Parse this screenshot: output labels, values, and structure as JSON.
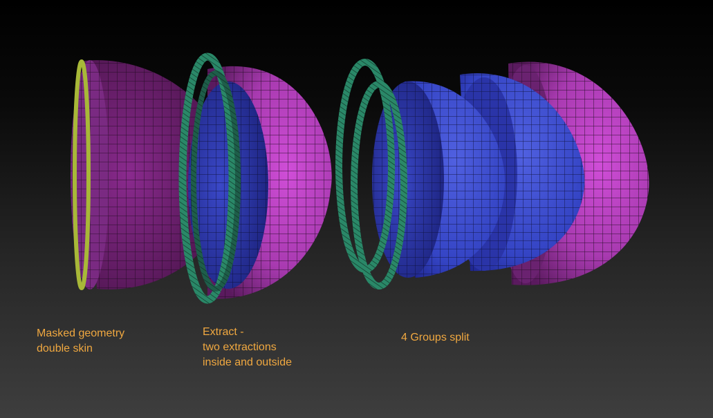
{
  "captions": {
    "masked": {
      "line1": "Masked geometry",
      "line2": "double skin"
    },
    "extract": {
      "line1": "Extract -",
      "line2": "two extractions",
      "line3": "inside and outside"
    },
    "groups": {
      "line1": "4 Groups split"
    }
  },
  "colors": {
    "magenta": "#b43cbc",
    "magenta_dark": "#5e1c5e",
    "blue": "#3c4ed0",
    "blue_dark": "#22299a",
    "green": "#2a8868",
    "yellow": "#9aa830",
    "caption": "#f0a840"
  }
}
